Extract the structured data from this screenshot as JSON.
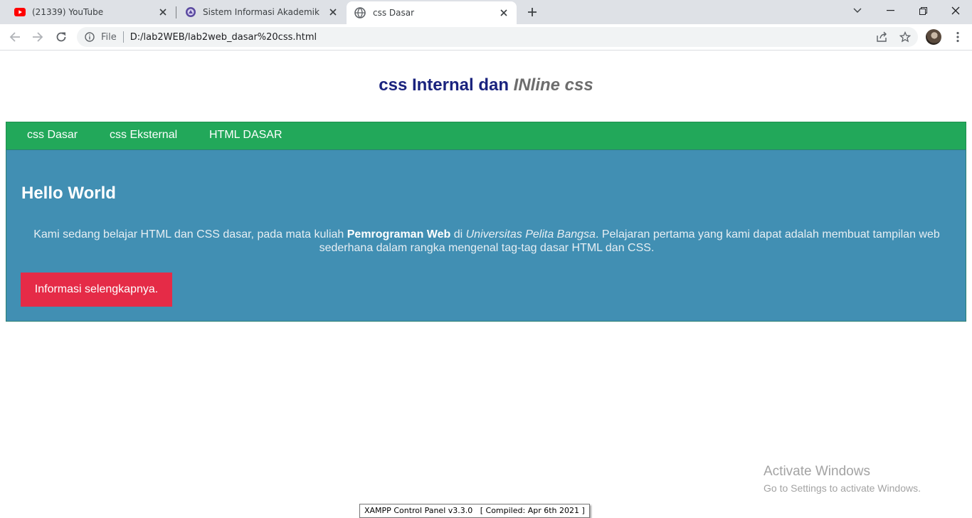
{
  "browser": {
    "tabs": [
      {
        "title": "(21339) YouTube",
        "icon": "youtube-icon",
        "active": false
      },
      {
        "title": "Sistem Informasi Akademik",
        "icon": "university-crest-icon",
        "active": false
      },
      {
        "title": "css Dasar",
        "icon": "globe-icon",
        "active": true
      }
    ],
    "address": {
      "scheme_label": "File",
      "url": "D:/lab2WEB/lab2web_dasar%20css.html"
    },
    "colors": {
      "tabstrip": "#dee1e6",
      "youtube_red": "#ff0000"
    }
  },
  "page": {
    "title_main": "css Internal dan ",
    "title_italic": "INline css",
    "nav": [
      "css Dasar",
      "css Eksternal",
      "HTML DASAR"
    ],
    "hero": {
      "heading": "Hello World",
      "text_1": "Kami sedang belajar HTML dan CSS dasar, pada mata kuliah ",
      "bold": "Pemrograman Web",
      "text_2": " di ",
      "italic": "Universitas Pelita Bangsa",
      "text_3": ". Pelajaran pertama yang kami dapat adalah membuat tampilan web sederhana dalam rangka mengenal tag-tag dasar HTML dan CSS.",
      "button": "Informasi selengkapnya."
    },
    "colors": {
      "title": "#1a237e",
      "nav_bg": "#22a85a",
      "hero_bg": "#418fb3",
      "button_bg": "#e52b47"
    }
  },
  "overlay": {
    "watermark_line1": "Activate Windows",
    "watermark_line2": "Go to Settings to activate Windows.",
    "tooltip": "XAMPP Control Panel v3.3.0   [ Compiled: Apr 6th 2021 ]"
  }
}
